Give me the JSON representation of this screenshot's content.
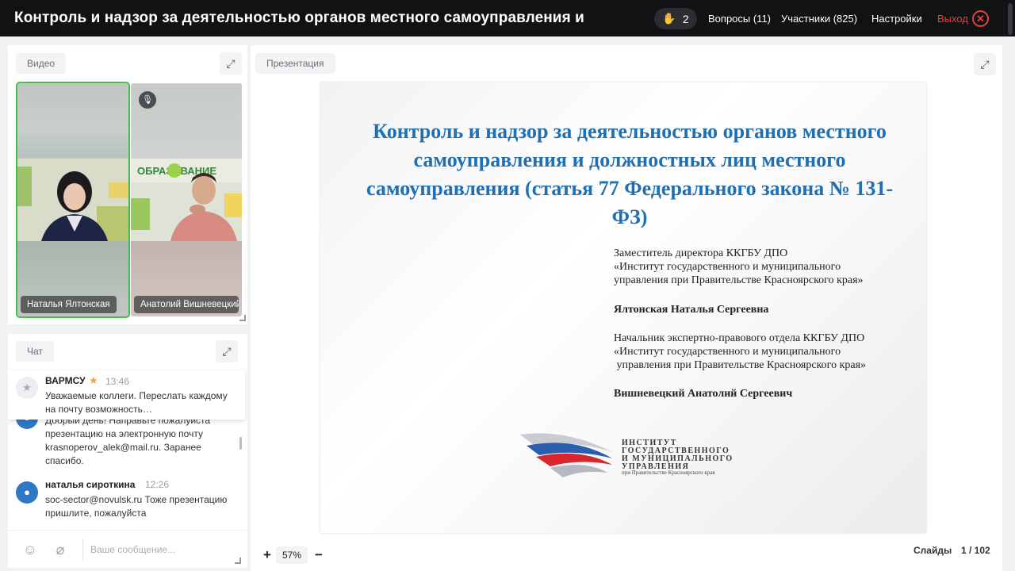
{
  "header": {
    "title": "Контроль и надзор за деятельностью органов местного самоуправления и",
    "hands_count": "2",
    "questions": "Вопросы (11)",
    "participants": "Участники (825)",
    "settings": "Настройки",
    "exit": "Выход"
  },
  "video": {
    "label": "Видео",
    "tiles": [
      {
        "name": "Наталья Ялтонская",
        "active": true
      },
      {
        "name": "Анатолий Вишневецкий",
        "muted": true,
        "bg_text": "ОБРАЗОВАНИЕ"
      }
    ]
  },
  "chat": {
    "label": "Чат",
    "pinned": {
      "author": "ВАРМСУ",
      "time": "13:46",
      "text": "Уважаемые коллеги. Переслать каждому на почту возможность…"
    },
    "messages": [
      {
        "author": "",
        "time": "",
        "text": "Добрый день! Направьте пожалуйста презентацию на электронную почту krasnoperov_alek@mail.ru. Заранее спасибо."
      },
      {
        "author": "наталья сироткина",
        "time": "12:26",
        "text": "soc-sector@novulsk.ru Тоже презентацию пришлите, пожалуйста"
      }
    ],
    "input_placeholder": "Ваше сообщение..."
  },
  "presentation": {
    "label": "Презентация",
    "slide": {
      "title": "Контроль и надзор за деятельностью органов местного самоуправления и должностных лиц местного самоуправления (статья 77 Федерального закона № 131-ФЗ)",
      "speaker1_role_lines": [
        "Заместитель директора ККГБУ ДПО",
        "«Институт государственного и муниципального",
        "управления при Правительстве Красноярского края»"
      ],
      "speaker1_name": "Ялтонская Наталья Сергеевна",
      "speaker2_role_lines": [
        "Начальник экспертно-правового отдела ККГБУ ДПО",
        "«Институт государственного и муниципального",
        " управления при Правительстве Красноярского края»"
      ],
      "speaker2_name": "Вишневецкий Анатолий Сергеевич",
      "logo_lines": [
        "ИНСТИТУТ",
        "ГОСУДАРСТВЕННОГО",
        "И МУНИЦИПАЛЬНОГО",
        "УПРАВЛЕНИЯ"
      ],
      "logo_sub": "при Правительстве Красноярского края"
    },
    "zoom": "57%",
    "slides_label": "Слайды",
    "slides_count": "1 / 102"
  },
  "colors": {
    "accent_green": "#3fbf4a",
    "exit_red": "#e8413d",
    "slide_title_blue": "#1f6fb3"
  }
}
